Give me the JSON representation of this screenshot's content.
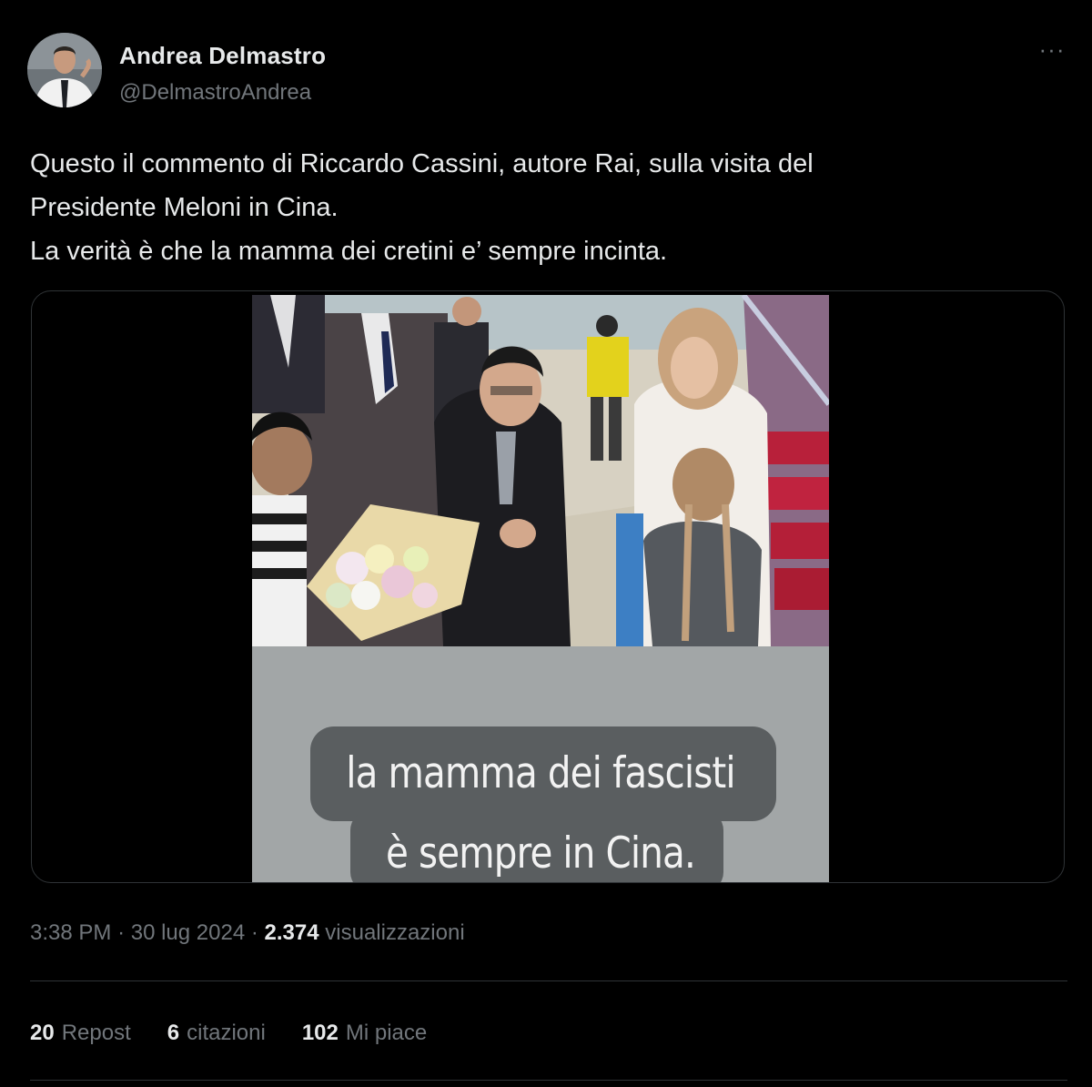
{
  "author": {
    "display_name": "Andrea Delmastro",
    "handle": "@DelmastroAndrea",
    "avatar": "avatar-photo"
  },
  "more_icon": "more-horizontal-icon",
  "more_glyph": "···",
  "tweet": {
    "lines": [
      "Questo il commento di Riccardo Cassini, autore Rai, sulla visita del",
      "Presidente Meloni in Cina.",
      "La verità è che la mamma dei cretini e’ sempre incinta."
    ]
  },
  "media": {
    "photo": "airport-welcome-photo",
    "caption_line_1": "la mamma dei fascisti",
    "caption_line_2": "è sempre in Cina."
  },
  "meta": {
    "time": "3:38 PM",
    "separator": "·",
    "date": "30 lug 2024",
    "views_count": "2.374",
    "views_label": "visualizzazioni"
  },
  "stats": {
    "reposts_count": "20",
    "reposts_label": "Repost",
    "quotes_count": "6",
    "quotes_label": "citazioni",
    "likes_count": "102",
    "likes_label": "Mi piace"
  },
  "colors": {
    "background": "#000000",
    "text_primary": "#e7e9ea",
    "text_secondary": "#71767b",
    "border": "#2f3336"
  }
}
